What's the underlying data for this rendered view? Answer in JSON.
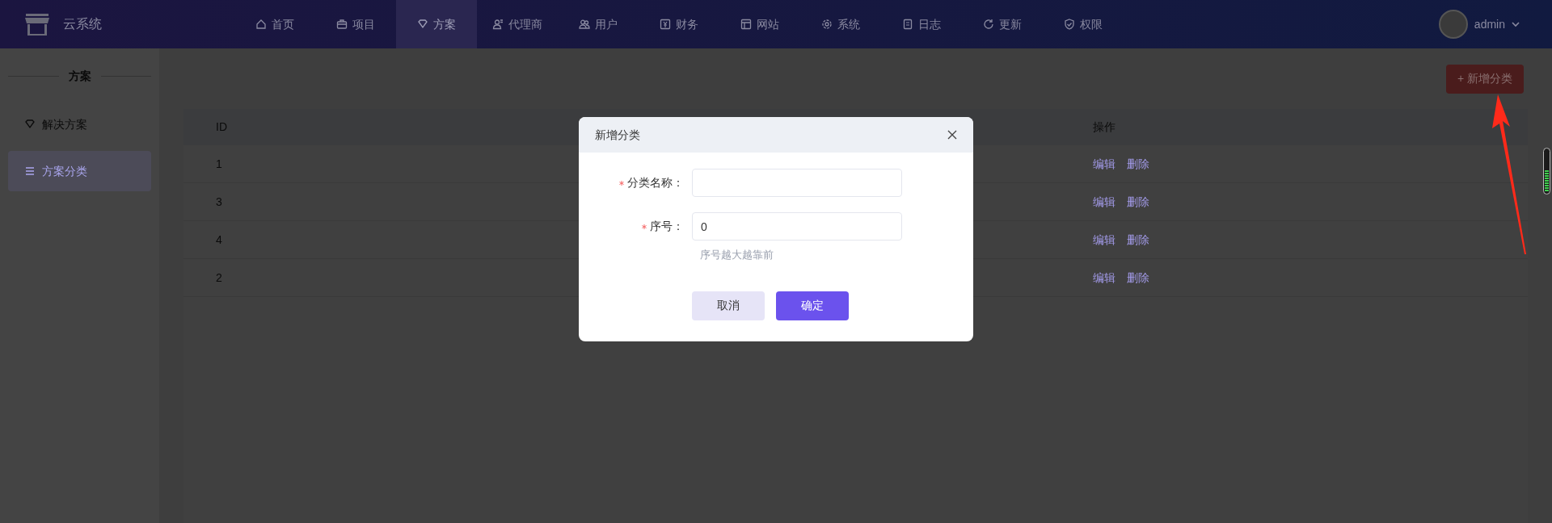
{
  "app": {
    "name": "云系统"
  },
  "nav": [
    {
      "label": "首页",
      "selected": false
    },
    {
      "label": "项目",
      "selected": false
    },
    {
      "label": "方案",
      "selected": true
    },
    {
      "label": "代理商",
      "selected": false
    },
    {
      "label": "用户",
      "selected": false
    },
    {
      "label": "财务",
      "selected": false
    },
    {
      "label": "网站",
      "selected": false
    },
    {
      "label": "系统",
      "selected": false
    },
    {
      "label": "日志",
      "selected": false
    },
    {
      "label": "更新",
      "selected": false
    },
    {
      "label": "权限",
      "selected": false
    }
  ],
  "user": {
    "name": "admin"
  },
  "sidebar": {
    "title": "方案",
    "items": [
      {
        "label": "解决方案",
        "selected": false
      },
      {
        "label": "方案分类",
        "selected": true
      }
    ]
  },
  "toolbar": {
    "add_button": "+ 新增分类"
  },
  "table": {
    "columns": [
      "ID",
      "操作"
    ],
    "rows": [
      {
        "id": "1",
        "actions": [
          "编辑",
          "删除"
        ]
      },
      {
        "id": "3",
        "actions": [
          "编辑",
          "删除"
        ]
      },
      {
        "id": "4",
        "actions": [
          "编辑",
          "删除"
        ]
      },
      {
        "id": "2",
        "actions": [
          "编辑",
          "删除"
        ]
      }
    ]
  },
  "dialog": {
    "title": "新增分类",
    "fields": [
      {
        "label": "分类名称：",
        "required": true
      },
      {
        "label": "序号：",
        "required": true,
        "value": "0",
        "hint": "序号越大越靠前"
      }
    ],
    "buttons": [
      {
        "label": "取消",
        "kind": "cancel"
      },
      {
        "label": "确定",
        "kind": "primary"
      }
    ]
  }
}
